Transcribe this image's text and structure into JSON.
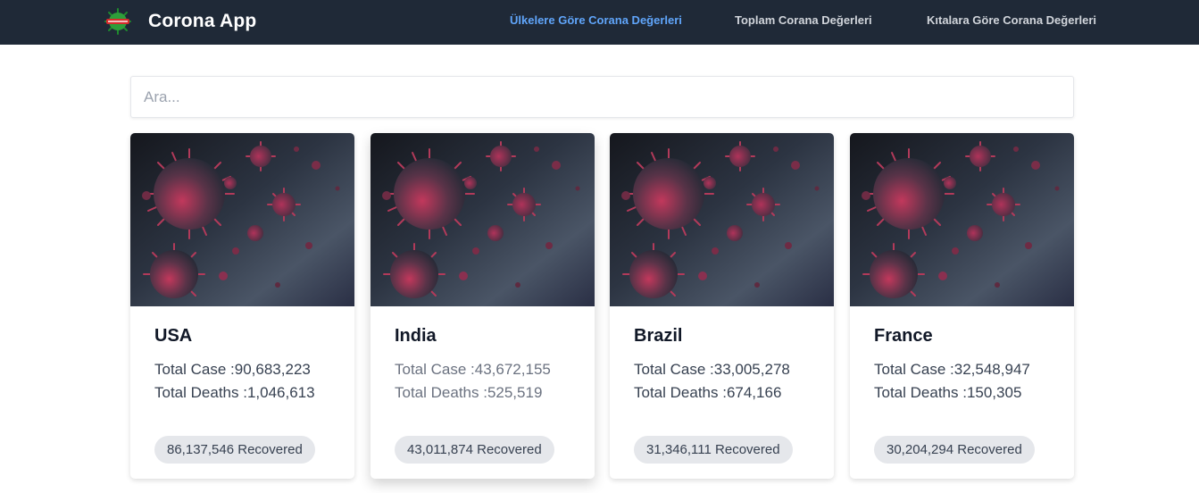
{
  "brand": {
    "title": "Corona App"
  },
  "nav": {
    "links": [
      {
        "label": "Ülkelere Göre Corana Değerleri",
        "active": true
      },
      {
        "label": "Toplam Corana Değerleri",
        "active": false
      },
      {
        "label": "Kıtalara Göre Corana Değerleri",
        "active": false
      }
    ]
  },
  "search": {
    "placeholder": "Ara...",
    "value": ""
  },
  "cards": [
    {
      "country": "USA",
      "total_case": "Total Case :90,683,223",
      "total_deaths": "Total Deaths :1,046,613",
      "recovered": "86,137,546 Recovered"
    },
    {
      "country": "India",
      "total_case": "Total Case :43,672,155",
      "total_deaths": "Total Deaths :525,519",
      "recovered": "43,011,874 Recovered"
    },
    {
      "country": "Brazil",
      "total_case": "Total Case :33,005,278",
      "total_deaths": "Total Deaths :674,166",
      "recovered": "31,346,111 Recovered"
    },
    {
      "country": "France",
      "total_case": "Total Case :32,548,947",
      "total_deaths": "Total Deaths :150,305",
      "recovered": "30,204,294 Recovered"
    }
  ],
  "colors": {
    "navbar": "#1f2937",
    "active_link": "#60a5fa",
    "link": "#d1d5db",
    "badge_bg": "#e5e7eb"
  },
  "icons": {
    "logo": "coronavirus-logo-icon",
    "card_image": "coronavirus-image"
  }
}
